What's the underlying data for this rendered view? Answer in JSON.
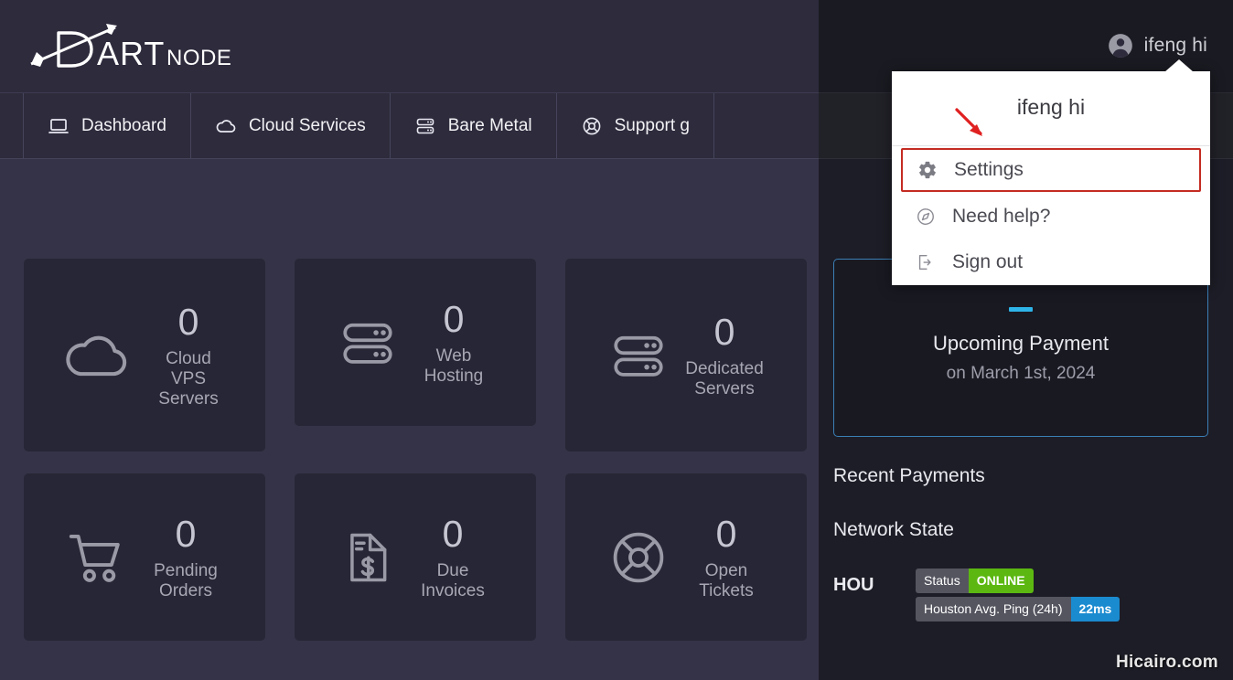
{
  "brand": {
    "name_primary": "ART",
    "name_secondary": "NODE",
    "full": "DartNode"
  },
  "header": {
    "user_name": "ifeng hi",
    "avatar_icon": "user-circle-icon"
  },
  "nav": {
    "items": [
      {
        "label": "Dashboard",
        "icon": "laptop-icon"
      },
      {
        "label": "Cloud Services",
        "icon": "cloud-icon"
      },
      {
        "label": "Bare Metal",
        "icon": "server-rack-icon"
      },
      {
        "label": "Support g",
        "icon": "lifebuoy-icon"
      }
    ]
  },
  "dropdown": {
    "title": "ifeng hi",
    "items": [
      {
        "label": "Settings",
        "icon": "gear-icon",
        "highlighted": true
      },
      {
        "label": "Need help?",
        "icon": "compass-icon",
        "highlighted": false
      },
      {
        "label": "Sign out",
        "icon": "sign-out-icon",
        "highlighted": false
      }
    ],
    "highlight_color": "#c42b22",
    "annotation_arrow_color": "#e02020"
  },
  "cards": [
    {
      "value": "0",
      "label": "Cloud VPS Servers",
      "icon": "cloud-icon"
    },
    {
      "value": "0",
      "label": "Web Hosting",
      "icon": "server-rack-icon"
    },
    {
      "value": "0",
      "label": "Dedicated Servers",
      "icon": "server-rack-icon"
    },
    {
      "value": "0",
      "label": "Pending Orders",
      "icon": "shopping-cart-icon"
    },
    {
      "value": "0",
      "label": "Due Invoices",
      "icon": "invoice-dollar-icon"
    },
    {
      "value": "0",
      "label": "Open Tickets",
      "icon": "lifebuoy-icon"
    }
  ],
  "upcoming_payment": {
    "title": "Upcoming Payment",
    "subtitle": "on March 1st, 2024",
    "accent_color": "#2eb4e8",
    "border_color": "#3a7fb5"
  },
  "recent_payments": {
    "heading": "Recent Payments"
  },
  "network_state": {
    "heading": "Network State",
    "node_label": "HOU",
    "status_key": "Status",
    "status_value": "ONLINE",
    "status_color": "#5cb811",
    "ping_key": "Houston Avg. Ping (24h)",
    "ping_value": "22ms",
    "ping_color": "#1b8bd0"
  },
  "watermark": {
    "text": "Hicairo.com"
  }
}
